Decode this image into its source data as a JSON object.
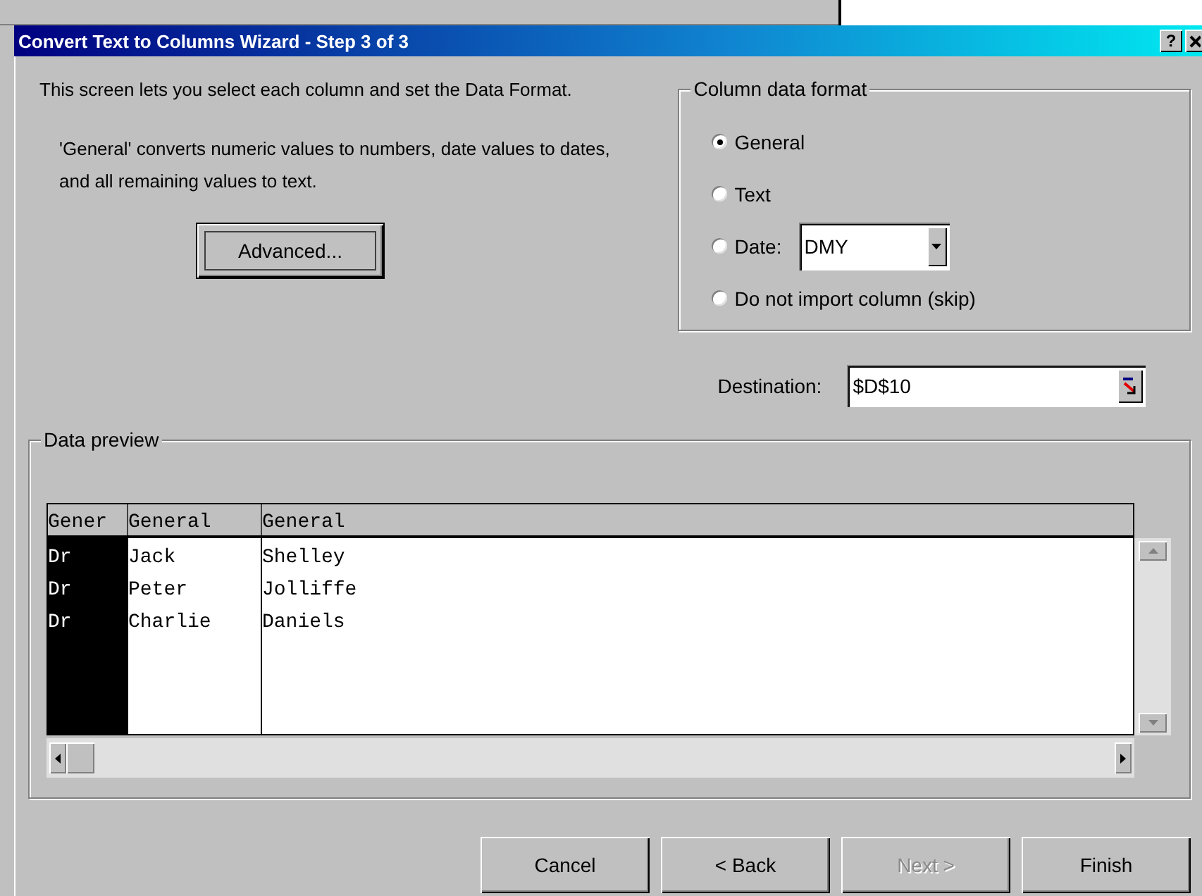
{
  "window": {
    "title": "Convert Text to Columns Wizard - Step 3 of 3",
    "help_button": "?"
  },
  "intro": "This screen lets you select each column and set the Data Format.",
  "note": "'General' converts numeric values to numbers, date values to dates, and all remaining values to text.",
  "advanced_button": "Advanced...",
  "column_data_format": {
    "title": "Column data format",
    "options": [
      {
        "label": "General",
        "selected": true
      },
      {
        "label": "Text",
        "selected": false
      },
      {
        "label": "Date:",
        "selected": false,
        "dropdown": "DMY"
      },
      {
        "label": "Do not import column (skip)",
        "selected": false
      }
    ]
  },
  "destination": {
    "label": "Destination:",
    "value": "$D$10"
  },
  "data_preview": {
    "title": "Data preview",
    "columns": [
      {
        "header": "Gener",
        "selected": true
      },
      {
        "header": "General",
        "selected": false
      },
      {
        "header": "General",
        "selected": false
      }
    ],
    "rows": [
      [
        "Dr",
        "Jack",
        "Shelley"
      ],
      [
        "Dr",
        "Peter",
        "Jolliffe"
      ],
      [
        "Dr",
        "Charlie",
        "Daniels"
      ]
    ]
  },
  "buttons": [
    {
      "label": "Cancel",
      "disabled": false
    },
    {
      "label": "< Back",
      "disabled": false
    },
    {
      "label": "Next >",
      "disabled": true
    },
    {
      "label": "Finish",
      "disabled": false
    }
  ]
}
